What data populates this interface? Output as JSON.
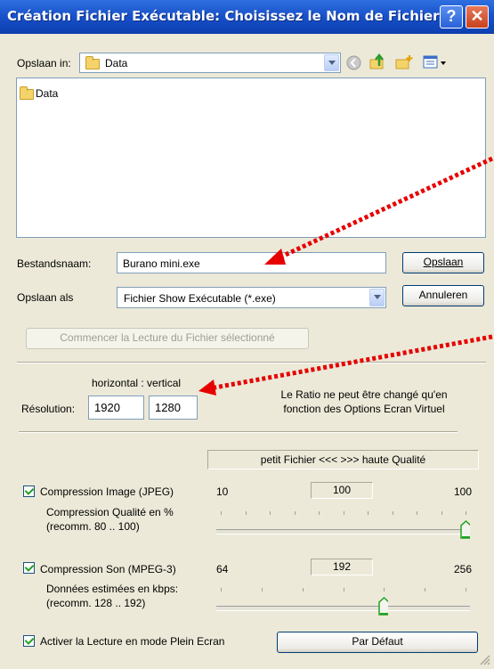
{
  "window": {
    "title": "Création Fichier Exécutable: Choisissez le Nom de Fichier",
    "help_glyph": "?",
    "close_glyph": "✕"
  },
  "toolbar": {
    "save_in_label": "Opslaan in:",
    "save_in_value": "Data"
  },
  "file_list": {
    "items": [
      "Data"
    ]
  },
  "filename": {
    "label": "Bestandsnaam:",
    "value": "Burano mini.exe",
    "save_button": "Opslaan"
  },
  "filetype": {
    "label": "Opslaan als",
    "value": "Fichier Show Exécutable (*.exe)",
    "cancel_button": "Annuleren"
  },
  "start_button": "Commencer la Lecture du Fichier sélectionné",
  "resolution": {
    "header": "horizontal : vertical",
    "label": "Résolution:",
    "horizontal": "1920",
    "vertical": "1280",
    "note_line1": "Le Ratio ne peut être changé qu'en",
    "note_line2": "fonction des Options Ecran Virtuel"
  },
  "quality_header": "petit Fichier <<<   >>> haute Qualité",
  "image_compression": {
    "label": "Compression Image (JPEG)",
    "min": "10",
    "value": "100",
    "max": "100",
    "desc_line1": "Compression Qualité en %",
    "desc_line2": "(recomm. 80 .. 100)",
    "slider_fraction": 1.0
  },
  "sound_compression": {
    "label": "Compression Son (MPEG-3)",
    "min": "64",
    "value": "192",
    "max": "256",
    "desc_line1": "Données estimées en kbps:",
    "desc_line2": "(recomm. 128 .. 192)",
    "slider_fraction": 0.667
  },
  "fullscreen": {
    "label": "Activer la Lecture en mode Plein Ecran",
    "default_button": "Par Défaut"
  },
  "colors": {
    "title_bar": "#1750c8",
    "dialog_bg": "#ece9d8",
    "annotation_arrow": "#e60000",
    "checkmark": "#21a121"
  }
}
